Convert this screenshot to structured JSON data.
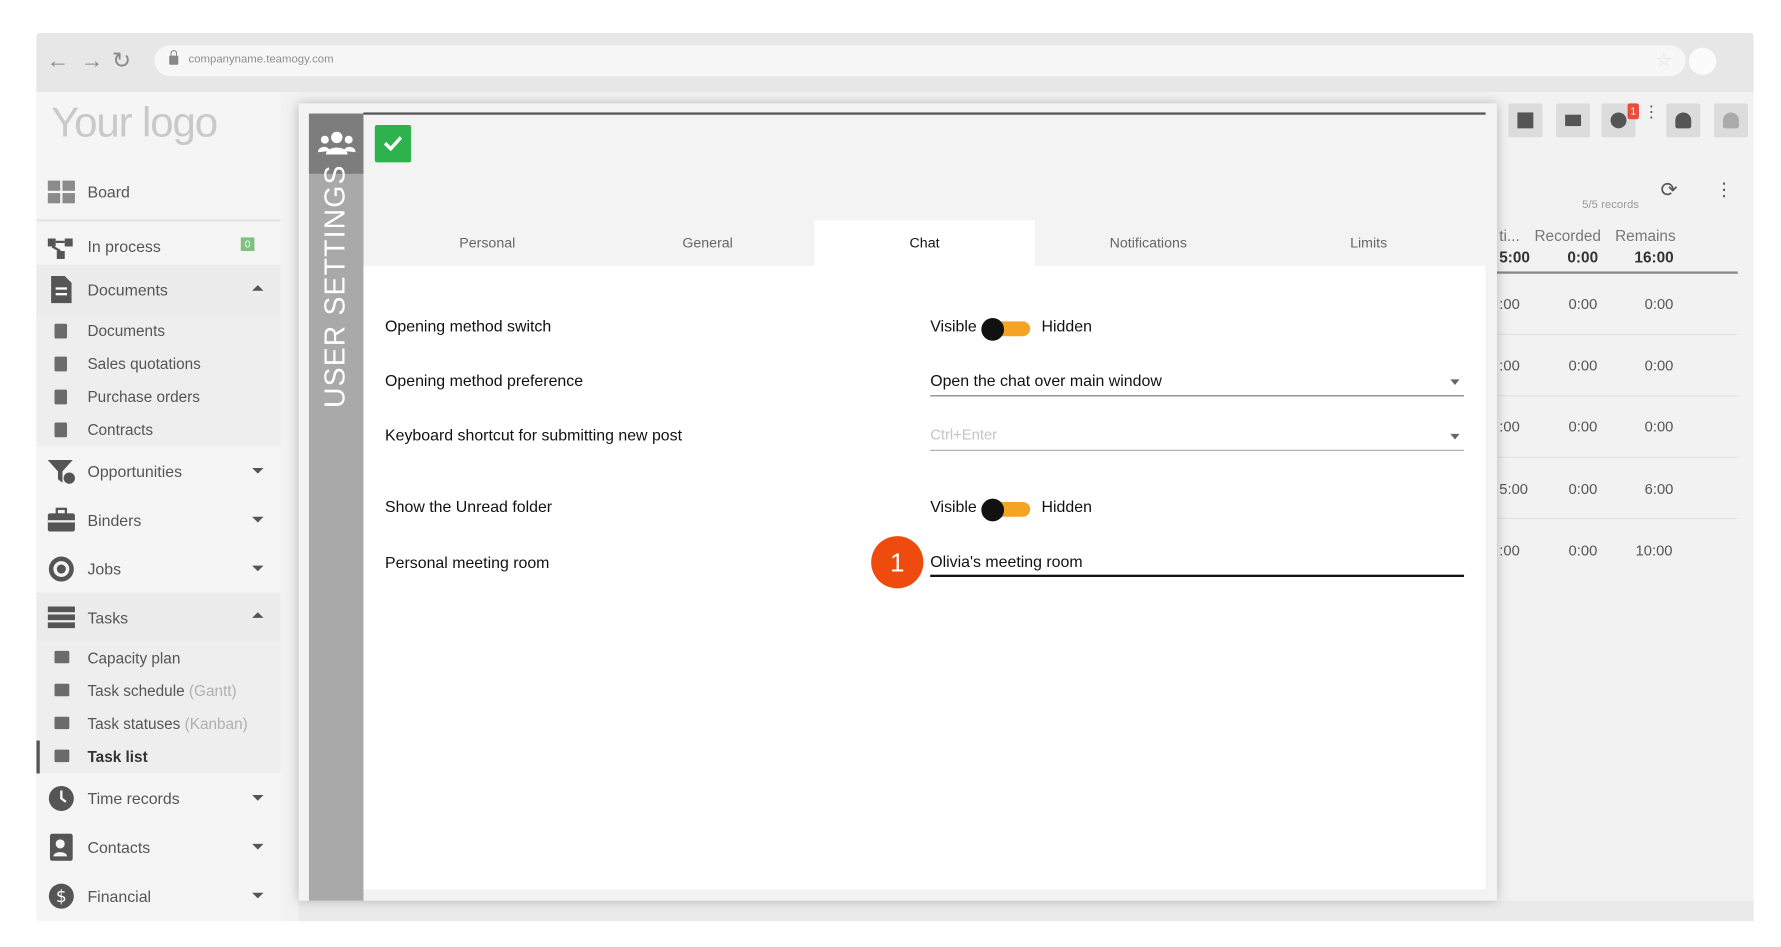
{
  "browser": {
    "url": "companyname.teamogy.com"
  },
  "app": {
    "logo": "Your logo"
  },
  "sidebar": {
    "items": [
      {
        "label": "Board"
      },
      {
        "label": "In process",
        "count": "0"
      },
      {
        "label": "Documents"
      },
      {
        "label": "Documents"
      },
      {
        "label": "Sales quotations"
      },
      {
        "label": "Purchase orders"
      },
      {
        "label": "Contracts"
      },
      {
        "label": "Opportunities"
      },
      {
        "label": "Binders"
      },
      {
        "label": "Jobs"
      },
      {
        "label": "Tasks"
      },
      {
        "label": "Capacity plan"
      },
      {
        "label": "Task schedule",
        "muted": "(Gantt)"
      },
      {
        "label": "Task statuses",
        "muted": "(Kanban)"
      },
      {
        "label": "Task list"
      },
      {
        "label": "Time records"
      },
      {
        "label": "Contacts"
      },
      {
        "label": "Financial"
      }
    ]
  },
  "header": {
    "chat_badge": "1"
  },
  "right_panel": {
    "records": "5/5 records",
    "columns": [
      "ti...",
      "Recorded",
      "Remains"
    ],
    "totals": [
      "5:00",
      "0:00",
      "16:00"
    ],
    "rows": [
      [
        ":00",
        "0:00",
        "0:00"
      ],
      [
        ":00",
        "0:00",
        "0:00"
      ],
      [
        ":00",
        "0:00",
        "0:00"
      ],
      [
        "5:00",
        "0:00",
        "6:00"
      ],
      [
        ":00",
        "0:00",
        "10:00"
      ]
    ]
  },
  "modal": {
    "title": "USER SETTINGS",
    "tabs": [
      "Personal",
      "General",
      "Chat",
      "Notifications",
      "Limits"
    ],
    "active_tab": "Chat",
    "settings": {
      "opening_switch": {
        "label": "Opening method switch",
        "on": "Visible",
        "off": "Hidden"
      },
      "opening_pref": {
        "label": "Opening method preference",
        "value": "Open the chat over main window"
      },
      "shortcut": {
        "label": "Keyboard shortcut for submitting new post",
        "placeholder": "Ctrl+Enter"
      },
      "unread": {
        "label": "Show the Unread folder",
        "on": "Visible",
        "off": "Hidden"
      },
      "meeting": {
        "label": "Personal meeting room",
        "value": "Olivia's meeting room"
      }
    },
    "marker": "1"
  },
  "colors": {
    "accent": "#f5a323",
    "ok": "#2db24e",
    "marker": "#f04b0f",
    "badge": "#e74c3c"
  }
}
